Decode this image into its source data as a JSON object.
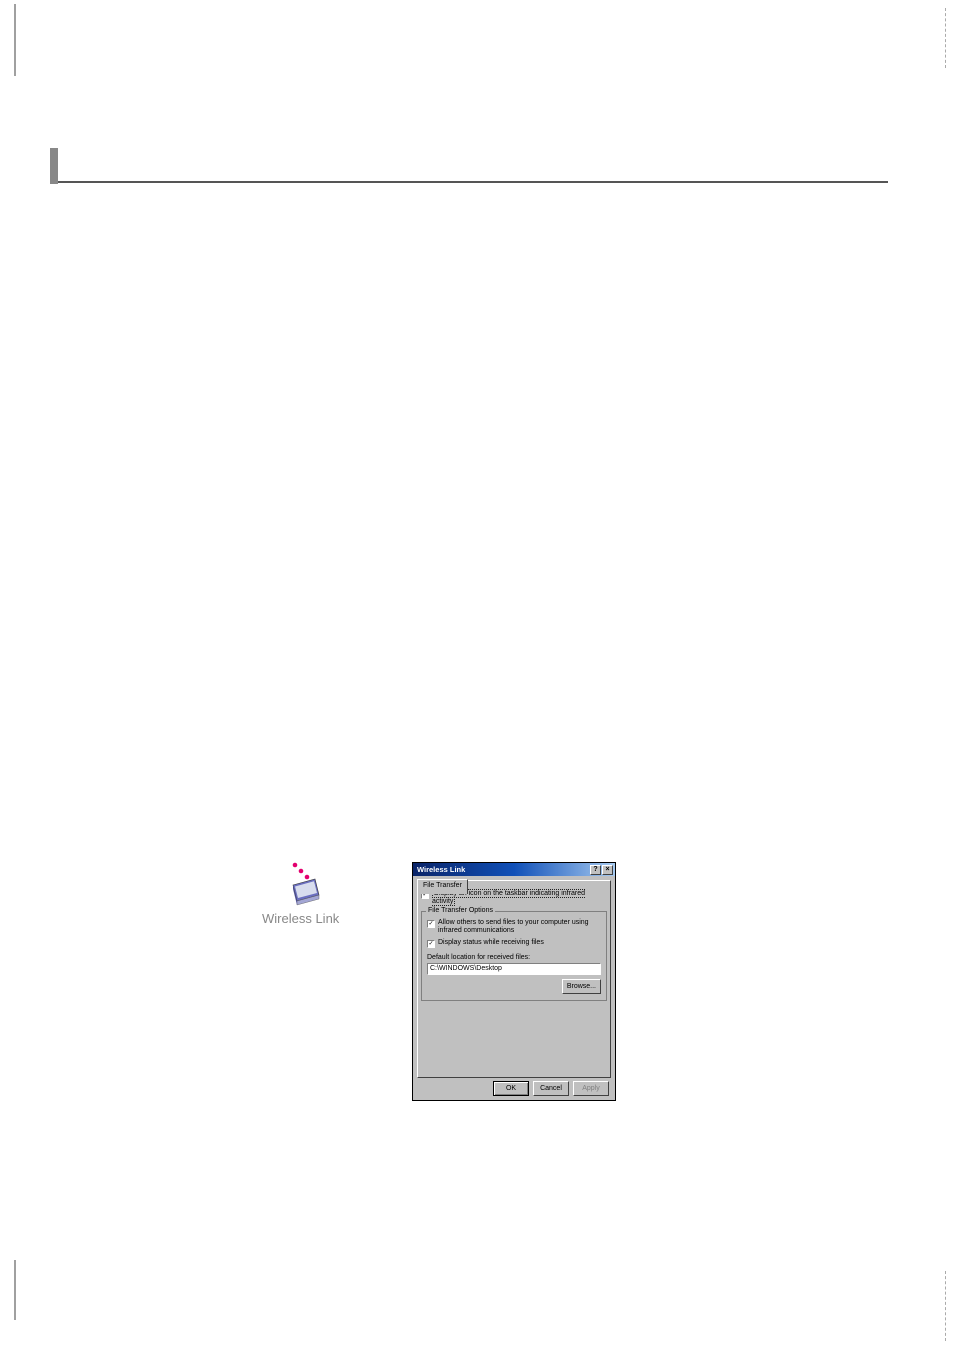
{
  "wireless_icon": {
    "label": "Wireless Link"
  },
  "dialog": {
    "title": "Wireless Link",
    "help_glyph": "?",
    "close_glyph": "×",
    "tab_label": "File Transfer",
    "checkbox_icon_taskbar": "Display an icon on the taskbar indicating infrared activity",
    "group_title": "File Transfer Options",
    "checkbox_allow_send": "Allow others to send files to your computer using infrared communications",
    "checkbox_status": "Display status while receiving files",
    "default_location_label": "Default location for received files:",
    "path_value": "C:\\WINDOWS\\Desktop",
    "browse_label": "Browse...",
    "ok_label": "OK",
    "cancel_label": "Cancel",
    "apply_label": "Apply"
  }
}
